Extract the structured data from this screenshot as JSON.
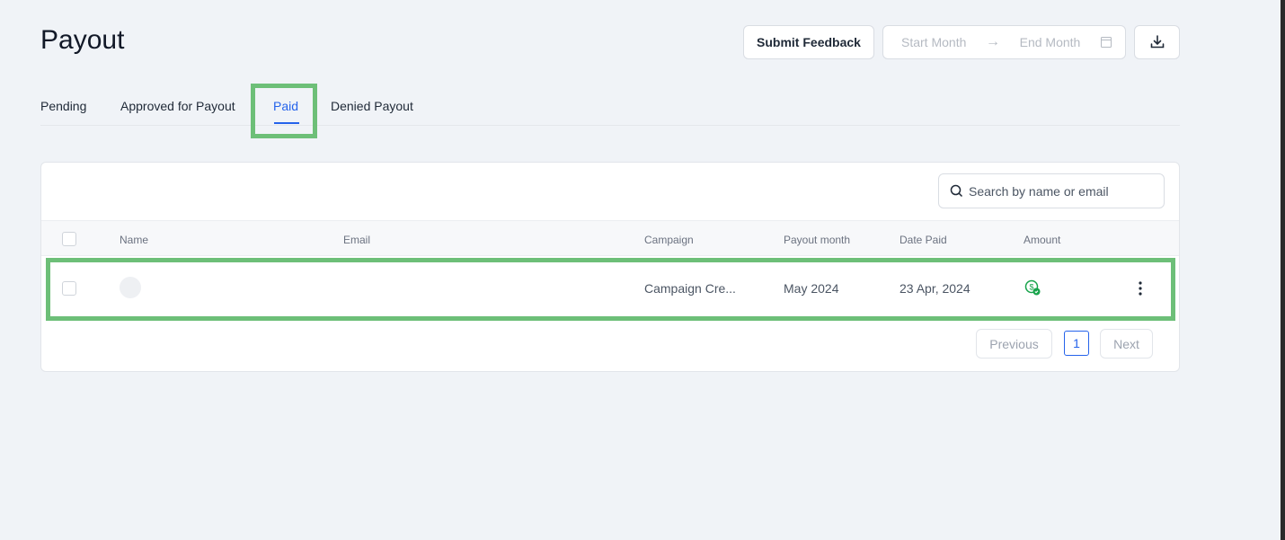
{
  "page": {
    "title": "Payout"
  },
  "toolbar": {
    "submit_feedback": "Submit Feedback",
    "start_placeholder": "Start Month",
    "end_placeholder": "End Month"
  },
  "tabs": [
    {
      "label": "Pending"
    },
    {
      "label": "Approved for Payout"
    },
    {
      "label": "Paid",
      "active": true
    },
    {
      "label": "Denied Payout"
    }
  ],
  "search": {
    "placeholder": "Search by name or email"
  },
  "table": {
    "headers": [
      "Name",
      "Email",
      "Campaign",
      "Payout month",
      "Date Paid",
      "Amount"
    ],
    "rows": [
      {
        "name": "",
        "email": "",
        "campaign": "Campaign Cre...",
        "payout_month": "May 2024",
        "date_paid": "23 Apr, 2024",
        "amount_icon": "dollar-check-icon"
      }
    ]
  },
  "pagination": {
    "previous": "Previous",
    "current": "1",
    "next": "Next"
  },
  "colors": {
    "accent": "#2563eb",
    "highlight": "#6dbf78",
    "paid": "#16a34a"
  }
}
